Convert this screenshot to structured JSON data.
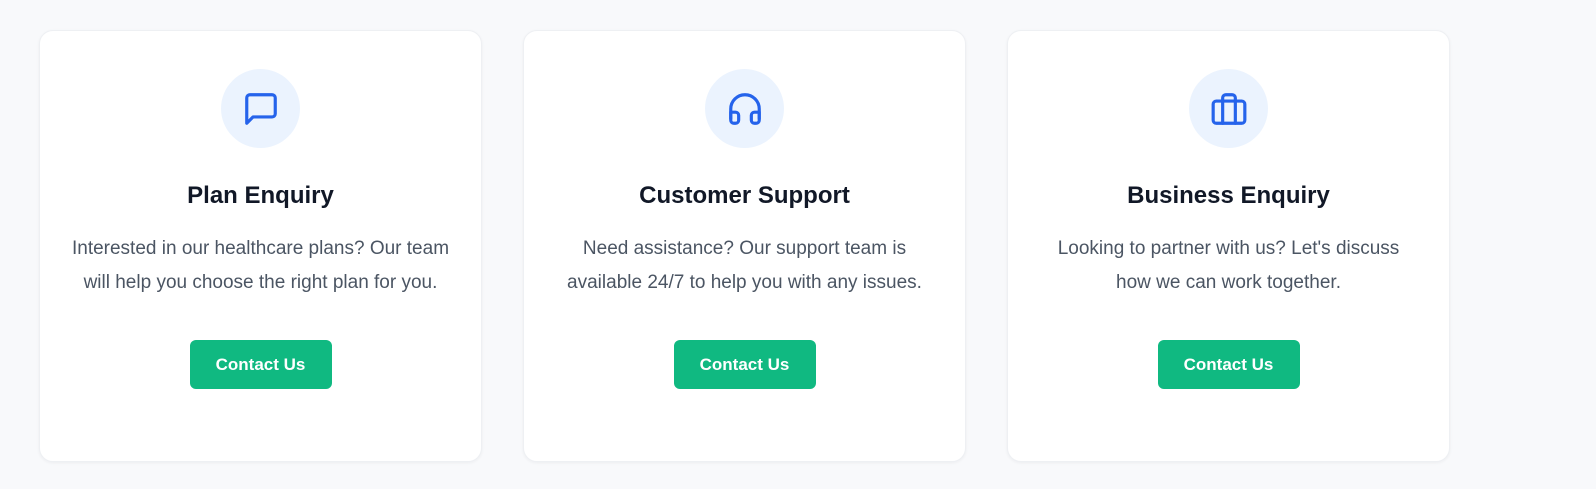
{
  "colors": {
    "page_background": "#f8f9fb",
    "card_background": "#ffffff",
    "icon_background": "#ebf3fe",
    "icon_stroke": "#2563eb",
    "button_background": "#10b981",
    "button_text": "#ffffff",
    "title_text": "#111827",
    "body_text": "#4b5563"
  },
  "cards": [
    {
      "icon": "message-square-icon",
      "title": "Plan Enquiry",
      "description": "Interested in our healthcare plans? Our team will help you choose the right plan for you.",
      "button_label": "Contact Us"
    },
    {
      "icon": "headphones-icon",
      "title": "Customer Support",
      "description": "Need assistance? Our support team is available 24/7 to help you with any issues.",
      "button_label": "Contact Us"
    },
    {
      "icon": "briefcase-icon",
      "title": "Business Enquiry",
      "description": "Looking to partner with us? Let's discuss how we can work together.",
      "button_label": "Contact Us"
    }
  ]
}
